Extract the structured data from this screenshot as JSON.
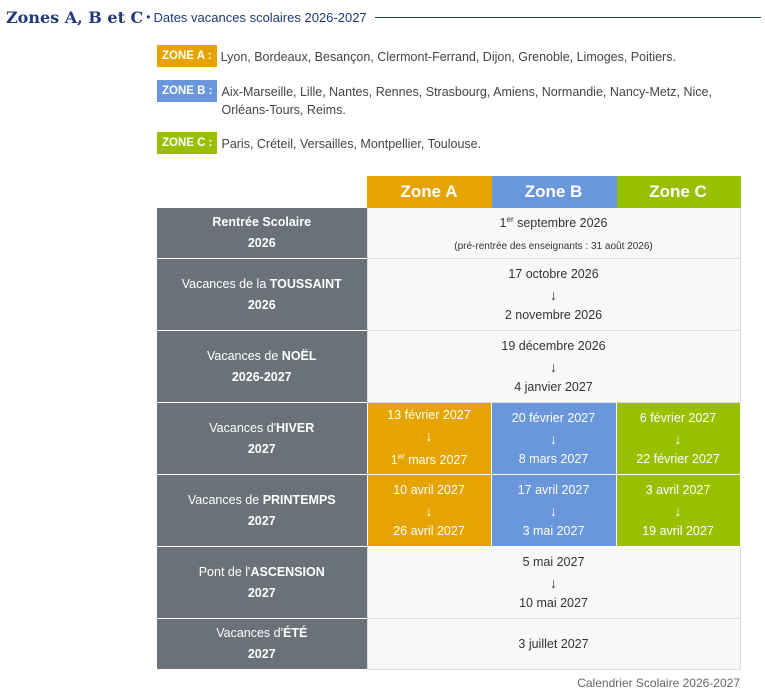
{
  "header": {
    "title": "Zones A, B et C",
    "separator": "•",
    "subtitle": "Dates vacances scolaires 2026-2027"
  },
  "zones": [
    {
      "badge": "ZONE A :",
      "cities": "Lyon, Bordeaux, Besançon, Clermont-Ferrand, Dijon, Grenoble, Limoges, Poitiers."
    },
    {
      "badge": "ZONE B :",
      "cities": "Aix-Marseille, Lille, Nantes, Rennes, Strasbourg, Amiens, Normandie, Nancy-Metz, Nice, Orléans-Tours, Reims."
    },
    {
      "badge": "ZONE C :",
      "cities": "Paris, Créteil, Versailles, Montpellier, Toulouse."
    }
  ],
  "table": {
    "headers": [
      "Zone A",
      "Zone B",
      "Zone C"
    ],
    "arrow": "↓",
    "rentree": {
      "label_bold": "Rentrée Scolaire",
      "year": "2026",
      "date_num": "1",
      "date_sup": "er",
      "date_rest": " septembre 2026",
      "note": "(pré-rentrée des enseignants : 31 août 2026)"
    },
    "toussaint": {
      "prefix": "Vacances de la ",
      "name": "TOUSSAINT",
      "year": "2026",
      "from": "17 octobre 2026",
      "to": "2 novembre 2026"
    },
    "noel": {
      "prefix": "Vacances de ",
      "name": "NOËL",
      "year": "2026-2027",
      "from": "19 décembre 2026",
      "to": "4 janvier 2027"
    },
    "hiver": {
      "prefix": "Vacances d'",
      "name": "HIVER",
      "year": "2027",
      "a_from": "13 février 2027",
      "a_to_num": "1",
      "a_to_sup": "er",
      "a_to_rest": " mars 2027",
      "b_from": "20 février 2027",
      "b_to": "8 mars 2027",
      "c_from": "6 février 2027",
      "c_to": "22 février 2027"
    },
    "printemps": {
      "prefix": "Vacances de ",
      "name": "PRINTEMPS",
      "year": "2027",
      "a_from": "10 avril 2027",
      "a_to": "26 avril 2027",
      "b_from": "17 avril 2027",
      "b_to": "3 mai 2027",
      "c_from": "3 avril 2027",
      "c_to": "19 avril 2027"
    },
    "ascension": {
      "prefix": "Pont de l'",
      "name": "ASCENSION",
      "year": "2027",
      "from": "5 mai 2027",
      "to": "10 mai 2027"
    },
    "ete": {
      "prefix": "Vacances d'",
      "name": "ÉTÉ",
      "year": "2027",
      "date": "3 juillet 2027"
    }
  },
  "caption": "Calendrier Scolaire 2026-2027",
  "colors": {
    "zone_a": "#e6a400",
    "zone_b": "#6a96dc",
    "zone_c": "#99c000",
    "label_bg": "#6b7178",
    "title": "#1e3a7b"
  }
}
